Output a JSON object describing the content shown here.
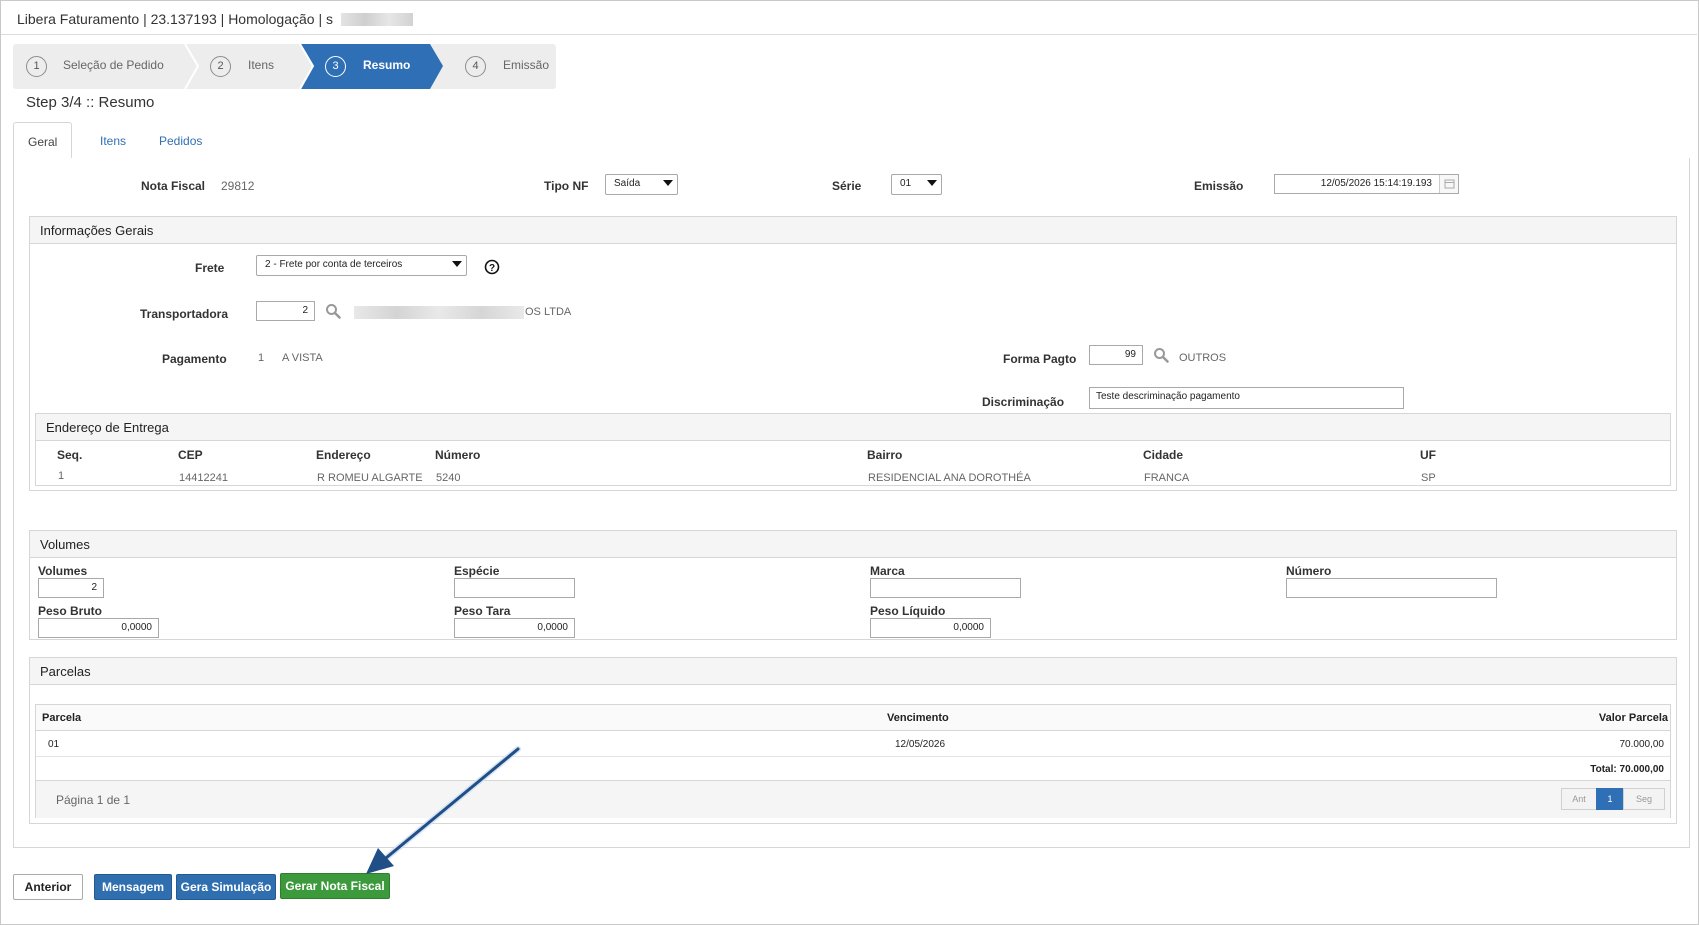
{
  "window": {
    "title": "Libera Faturamento | 23.137193 | Homologação | s"
  },
  "wizard": {
    "steps": [
      {
        "num": "1",
        "label": "Seleção de Pedido"
      },
      {
        "num": "2",
        "label": "Itens"
      },
      {
        "num": "3",
        "label": "Resumo"
      },
      {
        "num": "4",
        "label": "Emissão"
      }
    ],
    "active_step": 3,
    "heading": "Step 3/4 :: Resumo"
  },
  "tabs": [
    {
      "label": "Geral",
      "active": true
    },
    {
      "label": "Itens",
      "active": false
    },
    {
      "label": "Pedidos",
      "active": false
    }
  ],
  "header_fields": {
    "nota_fiscal_label": "Nota Fiscal",
    "nota_fiscal_value": "29812",
    "tipo_nf_label": "Tipo NF",
    "tipo_nf_value": "Saída",
    "serie_label": "Série",
    "serie_value": "01",
    "emissao_label": "Emissão",
    "emissao_value": "12/05/2026 15:14:19.193"
  },
  "informacoes_gerais": {
    "title": "Informações Gerais",
    "frete_label": "Frete",
    "frete_value": "2 - Frete por conta de terceiros",
    "transportadora_label": "Transportadora",
    "transportadora_code": "2",
    "transportadora_name": "OS LTDA",
    "pagamento_label": "Pagamento",
    "pagamento_code": "1",
    "pagamento_desc": "A VISTA",
    "forma_pagto_label": "Forma Pagto",
    "forma_pagto_code": "99",
    "forma_pagto_desc": "OUTROS",
    "discriminacao_label": "Discriminação",
    "discriminacao_value": "Teste descriminação pagamento"
  },
  "endereco_entrega": {
    "title": "Endereço de Entrega",
    "columns": [
      "Seq.",
      "CEP",
      "Endereço",
      "Número",
      "Bairro",
      "Cidade",
      "UF"
    ],
    "row": [
      "1",
      "14412241",
      "R ROMEU ALGARTE",
      "5240",
      "RESIDENCIAL ANA DOROTHÉA",
      "FRANCA",
      "SP"
    ]
  },
  "volumes": {
    "title": "Volumes",
    "volumes_label": "Volumes",
    "volumes_value": "2",
    "especie_label": "Espécie",
    "especie_value": "",
    "marca_label": "Marca",
    "marca_value": "",
    "numero_label": "Número",
    "numero_value": "",
    "peso_bruto_label": "Peso Bruto",
    "peso_bruto_value": "0,0000",
    "peso_tara_label": "Peso Tara",
    "peso_tara_value": "0,0000",
    "peso_liquido_label": "Peso Líquido",
    "peso_liquido_value": "0,0000"
  },
  "parcelas": {
    "title": "Parcelas",
    "columns": [
      "Parcela",
      "Vencimento",
      "Valor Parcela"
    ],
    "rows": [
      {
        "parcela": "01",
        "vencimento": "12/05/2026",
        "valor": "70.000,00"
      }
    ],
    "total": "Total: 70.000,00",
    "page_info": "Página 1 de 1",
    "pager": {
      "prev": "Ant",
      "current": "1",
      "next": "Seg"
    }
  },
  "actions": {
    "anterior": "Anterior",
    "mensagem": "Mensagem",
    "gera_simulacao": "Gera Simulação",
    "gerar_nota_fiscal": "Gerar Nota Fiscal"
  },
  "colors": {
    "active_step": "#2f6fb5",
    "primary_button": "#2f6fb0",
    "success_button": "#3c9a3c",
    "link": "#2f6fb5",
    "annotation_arrow": "#1f4f86"
  }
}
